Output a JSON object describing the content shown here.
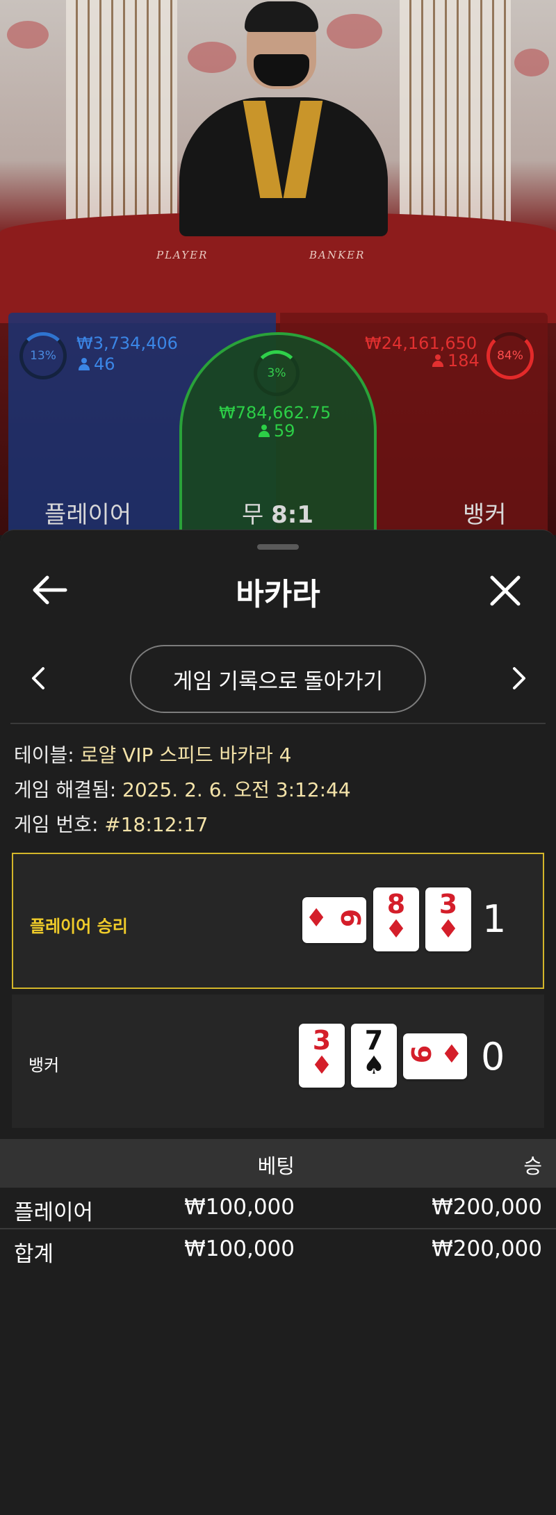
{
  "live_table": {
    "felt_labels": [
      "PLAYER",
      "BANKER"
    ],
    "player": {
      "percent": "13%",
      "amount": "₩3,734,406",
      "players": "46",
      "label": "플레이어",
      "color": "#2f74d0"
    },
    "tie": {
      "percent": "3%",
      "amount": "₩784,662.75",
      "players": "59",
      "label": "무",
      "payout": "8:1",
      "color": "#2fd04a"
    },
    "banker": {
      "percent": "84%",
      "amount": "₩24,161,650",
      "players": "184",
      "label": "뱅커",
      "color": "#e32a2a"
    }
  },
  "sheet": {
    "title": "바카라",
    "back_icon": "arrow-left-icon",
    "close_icon": "close-icon",
    "return_button": "게임 기록으로 돌아가기",
    "prev_icon": "chevron-left-icon",
    "next_icon": "chevron-right-icon",
    "info": [
      {
        "label": "테이블: ",
        "value": "로얄 VIP 스피드 바카라 4"
      },
      {
        "label": "게임 해결됨: ",
        "value": "2025. 2. 6. 오전 3:12:44"
      },
      {
        "label": "게임 번호: ",
        "value": "#18:12:17"
      }
    ],
    "results": [
      {
        "label": "플레이어 승리",
        "score": "1",
        "winner": true,
        "cards": [
          {
            "rank": "6",
            "suit": "♦",
            "orientation": "sideways"
          },
          {
            "rank": "8",
            "suit": "♦"
          },
          {
            "rank": "3",
            "suit": "♦"
          }
        ]
      },
      {
        "label": "뱅커",
        "score": "0",
        "winner": false,
        "cards": [
          {
            "rank": "3",
            "suit": "♦"
          },
          {
            "rank": "7",
            "suit": "♠"
          },
          {
            "rank": "6",
            "suit": "♦",
            "orientation": "sideways"
          }
        ]
      }
    ],
    "bets_table": {
      "headers": [
        "",
        "베팅",
        "승"
      ],
      "rows": [
        [
          "플레이어",
          "₩100,000",
          "₩200,000"
        ]
      ],
      "total": [
        "합계",
        "₩100,000",
        "₩200,000"
      ]
    },
    "win_color": "#d4b62a"
  }
}
